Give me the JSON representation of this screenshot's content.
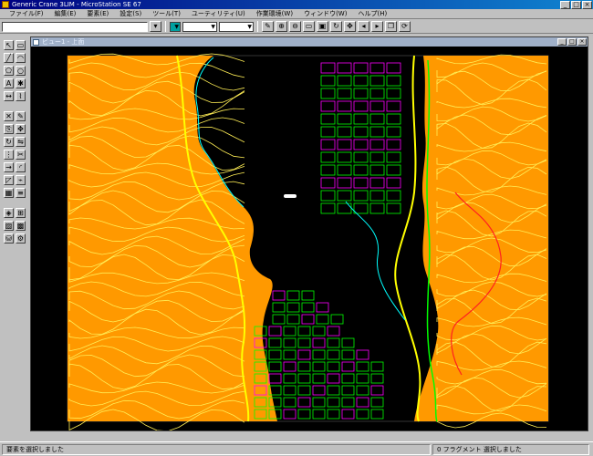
{
  "app": {
    "title": "Generic Crane 3LIM - MicroStation SE 67",
    "window_buttons": [
      "_",
      "□",
      "×"
    ]
  },
  "menubar": {
    "items": [
      "ファイル(F)",
      "編集(E)",
      "要素(E)",
      "設定(S)",
      "ツール(T)",
      "ユーティリティ(U)",
      "作業環境(W)",
      "ウィンドウ(W)",
      "ヘルプ(H)"
    ]
  },
  "toolbar": {
    "active_level": "",
    "color_index": "",
    "line_style": "",
    "line_weight": "",
    "buttons": [
      "draw-icon",
      "zoom-in-icon",
      "zoom-out-icon",
      "window-area-icon",
      "fit-view-icon",
      "rotate-icon",
      "pan-icon",
      "view-previous-icon",
      "view-next-icon",
      "copy-view-icon",
      "refresh-icon"
    ]
  },
  "palette": {
    "tools": [
      "select-icon",
      "fence-icon",
      "line-icon",
      "arc-icon",
      "polygon-icon",
      "circle-icon",
      "text-icon",
      "cell-icon",
      "dimension-icon",
      "measure-icon",
      "delete-icon",
      "modify-icon",
      "copy-icon",
      "move-icon",
      "rotate-tool-icon",
      "mirror-icon",
      "array-icon",
      "trim-icon",
      "extend-icon",
      "fillet-icon",
      "chamfer-icon",
      "break-icon",
      "group-icon",
      "level-icon",
      "attribute-icon",
      "reference-icon",
      "raster-icon",
      "pattern-icon",
      "database-icon",
      "settings-icon"
    ]
  },
  "view": {
    "title": "ビュー1 - 上面",
    "window_buttons": [
      "_",
      "□",
      "×"
    ]
  },
  "colors": {
    "contour": "#ff9900",
    "contour_highlight": "#ffee55",
    "roads": "#ffff00",
    "streets": "#00ff00",
    "magenta": "#ff00ff",
    "cyan": "#00ffff",
    "red": "#ff2020",
    "water": "#000000"
  },
  "status": {
    "left": "要素を選択しました",
    "right": "0 フラグメント 選択しました"
  }
}
